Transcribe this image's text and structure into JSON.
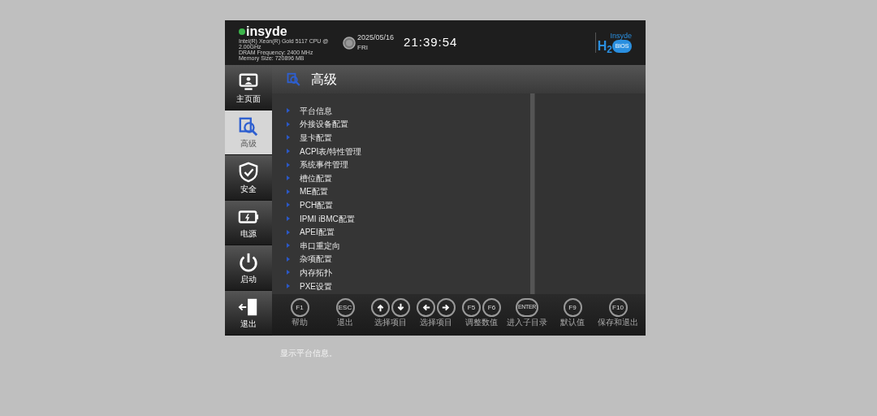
{
  "header": {
    "logo": "insyde",
    "info": [
      "Intel(R) Xeon(R) Gold 5117 CPU @ 2.00GHz",
      "DRAM Frequency: 2400 MHz",
      "Memory Size: 720896 MB"
    ],
    "date": "2025/05/16",
    "day": "FRI",
    "time": "21:39:54",
    "logo_right": {
      "top": "Insyde",
      "mark": "H$_{2}$",
      "badge": "BIOS"
    }
  },
  "sidebar": {
    "items": [
      {
        "label": "主页面",
        "kind": "monitor",
        "selected": false
      },
      {
        "label": "高级",
        "kind": "advanced",
        "selected": true
      },
      {
        "label": "安全",
        "kind": "shield",
        "selected": false
      },
      {
        "label": "电源",
        "kind": "battery",
        "selected": false
      },
      {
        "label": "启动",
        "kind": "power",
        "selected": false
      },
      {
        "label": "退出",
        "kind": "exit",
        "selected": false
      }
    ]
  },
  "page_title": "高级",
  "menu": {
    "items": [
      "平台信息",
      "外接设备配置",
      "显卡配置",
      "ACPI表/特性管理",
      "系统事件管理",
      "槽位配置",
      "ME配置",
      "PCH配置",
      "IPMI iBMC配置",
      "APEI配置",
      "串口重定向",
      "杂项配置",
      "内存拓扑",
      "PXE设置"
    ]
  },
  "keys": [
    {
      "keys": [
        {
          "kind": "text",
          "text": "F1"
        }
      ],
      "label": "帮助"
    },
    {
      "keys": [
        {
          "kind": "text",
          "text": "ESC"
        }
      ],
      "label": "退出"
    },
    {
      "keys": [
        {
          "kind": "up"
        },
        {
          "kind": "down"
        }
      ],
      "label": "选择项目"
    },
    {
      "keys": [
        {
          "kind": "left"
        },
        {
          "kind": "right"
        }
      ],
      "label": "选择项目"
    },
    {
      "keys": [
        {
          "kind": "text",
          "text": "F5"
        },
        {
          "kind": "text",
          "text": "F6"
        }
      ],
      "label": "调整数值"
    },
    {
      "keys": [
        {
          "kind": "text",
          "text": "ENTER"
        }
      ],
      "label": "进入子目录"
    },
    {
      "keys": [
        {
          "kind": "text",
          "text": "F9"
        }
      ],
      "label": "默认值"
    },
    {
      "keys": [
        {
          "kind": "text",
          "text": "F10"
        }
      ],
      "label": "保存和退出"
    }
  ],
  "status": "显示平台信息。"
}
